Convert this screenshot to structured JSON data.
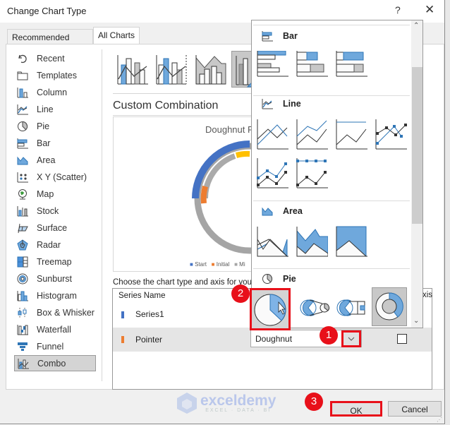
{
  "window": {
    "title": "Change Chart Type",
    "help_label": "?",
    "close_label": "✕"
  },
  "tabs": [
    {
      "label": "Recommended Charts",
      "active": false
    },
    {
      "label": "All Charts",
      "active": true
    }
  ],
  "sidebar": {
    "items": [
      {
        "label": "Recent",
        "icon": "recent-icon"
      },
      {
        "label": "Templates",
        "icon": "templates-icon"
      },
      {
        "label": "Column",
        "icon": "column-chart-icon"
      },
      {
        "label": "Line",
        "icon": "line-chart-icon"
      },
      {
        "label": "Pie",
        "icon": "pie-chart-icon"
      },
      {
        "label": "Bar",
        "icon": "bar-chart-icon"
      },
      {
        "label": "Area",
        "icon": "area-chart-icon"
      },
      {
        "label": "X Y (Scatter)",
        "icon": "scatter-chart-icon"
      },
      {
        "label": "Map",
        "icon": "map-chart-icon"
      },
      {
        "label": "Stock",
        "icon": "stock-chart-icon"
      },
      {
        "label": "Surface",
        "icon": "surface-chart-icon"
      },
      {
        "label": "Radar",
        "icon": "radar-chart-icon"
      },
      {
        "label": "Treemap",
        "icon": "treemap-chart-icon"
      },
      {
        "label": "Sunburst",
        "icon": "sunburst-chart-icon"
      },
      {
        "label": "Histogram",
        "icon": "histogram-chart-icon"
      },
      {
        "label": "Box & Whisker",
        "icon": "box-whisker-chart-icon"
      },
      {
        "label": "Waterfall",
        "icon": "waterfall-chart-icon"
      },
      {
        "label": "Funnel",
        "icon": "funnel-chart-icon"
      },
      {
        "label": "Combo",
        "icon": "combo-chart-icon",
        "selected": true
      }
    ]
  },
  "combo_subtypes": [
    {
      "name": "clustered-column-line",
      "selected": false
    },
    {
      "name": "clustered-column-line-secondary-axis",
      "selected": false
    },
    {
      "name": "stacked-area-clustered-column",
      "selected": false
    },
    {
      "name": "custom-combination",
      "selected": true
    }
  ],
  "main": {
    "heading": "Custom Combination",
    "preview": {
      "title": "Doughnut P",
      "legend": [
        "Start",
        "Initial",
        "Mi"
      ],
      "colors": {
        "start": "#4472c4",
        "initial": "#ed7d31",
        "mid": "#a5a5a5",
        "accent": "#ffc000"
      }
    },
    "instruction": "Choose the chart type and axis for your",
    "table": {
      "header_series": "Series Name",
      "header_axis": "xis",
      "rows": [
        {
          "name": "Series1",
          "color": "#4472c4",
          "selected": false
        },
        {
          "name": "Pointer",
          "color": "#ed7d31",
          "selected": true,
          "chart_type": "Doughnut",
          "secondary_axis": false
        }
      ]
    }
  },
  "dropdown_popup": {
    "sections": [
      {
        "label": "Bar",
        "icon": "bar-chart-icon",
        "options": [
          "clustered-bar",
          "stacked-bar",
          "100-stacked-bar"
        ]
      },
      {
        "label": "Line",
        "icon": "line-chart-icon",
        "options": [
          "line",
          "stacked-line",
          "100-stacked-line",
          "line-with-markers",
          "stacked-line-with-markers",
          "100-stacked-line-with-markers"
        ]
      },
      {
        "label": "Area",
        "icon": "area-chart-icon",
        "options": [
          "area",
          "stacked-area",
          "100-stacked-area"
        ]
      },
      {
        "label": "Pie",
        "icon": "pie-chart-icon",
        "options": [
          "pie",
          "pie-of-pie",
          "bar-of-pie",
          "doughnut"
        ]
      }
    ]
  },
  "annotations": {
    "step1": "1",
    "step2": "2",
    "step3": "3",
    "highlight_color": "#e8101a"
  },
  "buttons": {
    "ok": "OK",
    "cancel": "Cancel"
  },
  "watermark": {
    "name": "exceldemy",
    "tagline": "EXCEL · DATA · BI"
  }
}
